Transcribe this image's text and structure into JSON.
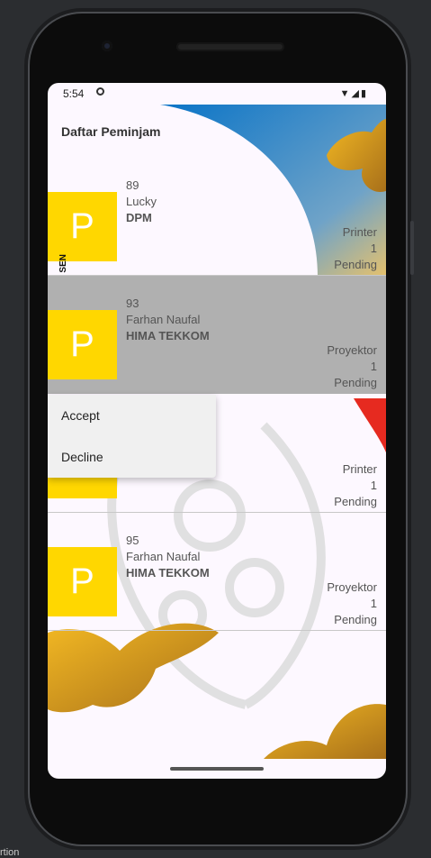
{
  "status_bar": {
    "time": "5:54",
    "icons": "▼◢▮"
  },
  "header": {
    "title": "Daftar Peminjam"
  },
  "side_label": "SEN",
  "rows": [
    {
      "avatar_letter": "P",
      "id": "89",
      "name": "Lucky",
      "org": "DPM",
      "item": "Printer",
      "qty": "1",
      "status": "Pending"
    },
    {
      "avatar_letter": "P",
      "id": "93",
      "name": "Farhan Naufal",
      "org": "HIMA TEKKOM",
      "item": "Proyektor",
      "qty": "1",
      "status": "Pending"
    },
    {
      "avatar_letter": "P",
      "id": "",
      "name": "",
      "org": "",
      "item": "Printer",
      "qty": "1",
      "status": "Pending"
    },
    {
      "avatar_letter": "P",
      "id": "95",
      "name": "Farhan Naufal",
      "org": "HIMA TEKKOM",
      "item": "Proyektor",
      "qty": "1",
      "status": "Pending"
    }
  ],
  "context_menu": {
    "accept_label": "Accept",
    "decline_label": "Decline"
  },
  "footer_text": "rtion",
  "colors": {
    "badge": "#ffd700",
    "highlight_row": "#b0b0b0",
    "blue_accent": "#0a74c7",
    "gold_accent": "#d9a11a"
  }
}
